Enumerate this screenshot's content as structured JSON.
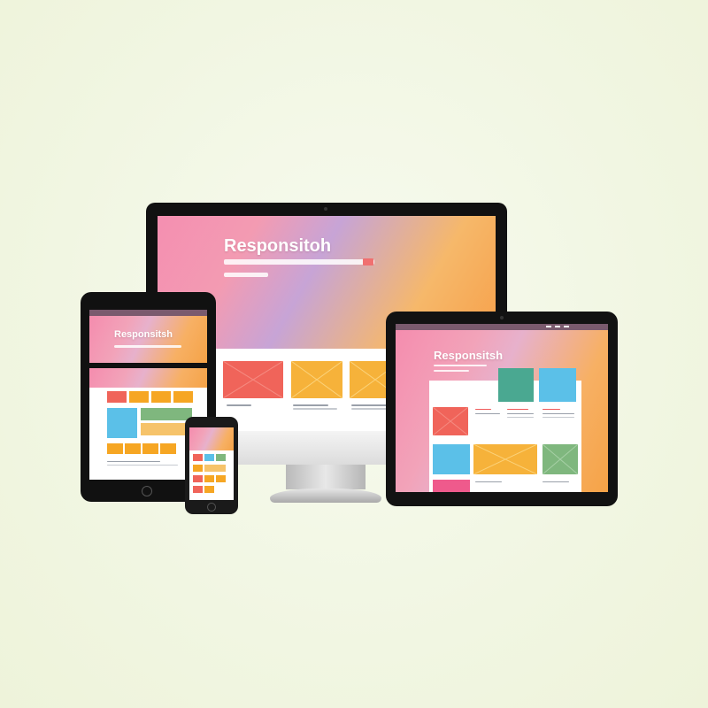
{
  "scene": {
    "description_title": "",
    "hero_text": {
      "monitor": "Responsitoh",
      "laptop_tablet": "Responsitsh",
      "left_tablet": "Responsitsh"
    },
    "colors": {
      "coral": "#f0645a",
      "orange": "#f6a623",
      "teal": "#4aa891",
      "sky": "#5bc0e8",
      "green": "#7fb77e",
      "pink": "#ef5a8c",
      "bezel": "#141414",
      "stand": "#c9c9c9"
    },
    "icons": [
      "monitor-icon",
      "tablet-icon",
      "phone-icon",
      "image-placeholder-icon"
    ]
  }
}
